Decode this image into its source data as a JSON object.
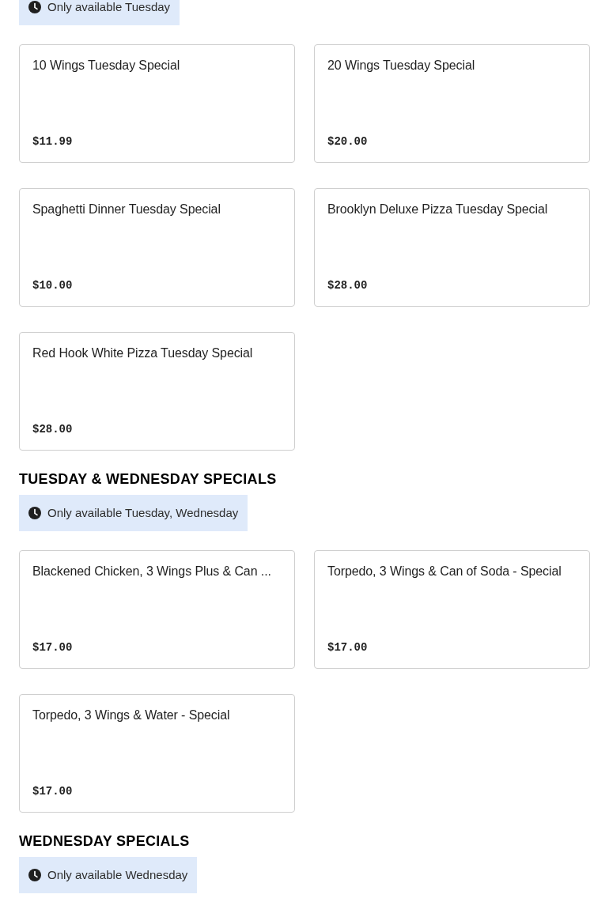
{
  "sections": [
    {
      "availability": "Only available Tuesday",
      "items": [
        {
          "name": "10 Wings Tuesday Special",
          "price": "$11.99"
        },
        {
          "name": "20 Wings Tuesday Special",
          "price": "$20.00"
        },
        {
          "name": "Spaghetti Dinner Tuesday Special",
          "price": "$10.00"
        },
        {
          "name": "Brooklyn Deluxe Pizza Tuesday Special",
          "price": "$28.00"
        },
        {
          "name": "Red Hook White Pizza Tuesday Special",
          "price": "$28.00"
        }
      ]
    },
    {
      "title": "TUESDAY & WEDNESDAY SPECIALS",
      "availability": "Only available Tuesday, Wednesday",
      "items": [
        {
          "name": "Blackened Chicken, 3 Wings Plus & Can ...",
          "price": "$17.00"
        },
        {
          "name": "Torpedo, 3 Wings & Can of Soda - Special",
          "price": "$17.00"
        },
        {
          "name": "Torpedo, 3 Wings & Water - Special",
          "price": "$17.00"
        }
      ]
    },
    {
      "title": "WEDNESDAY SPECIALS",
      "availability": "Only available Wednesday"
    }
  ]
}
